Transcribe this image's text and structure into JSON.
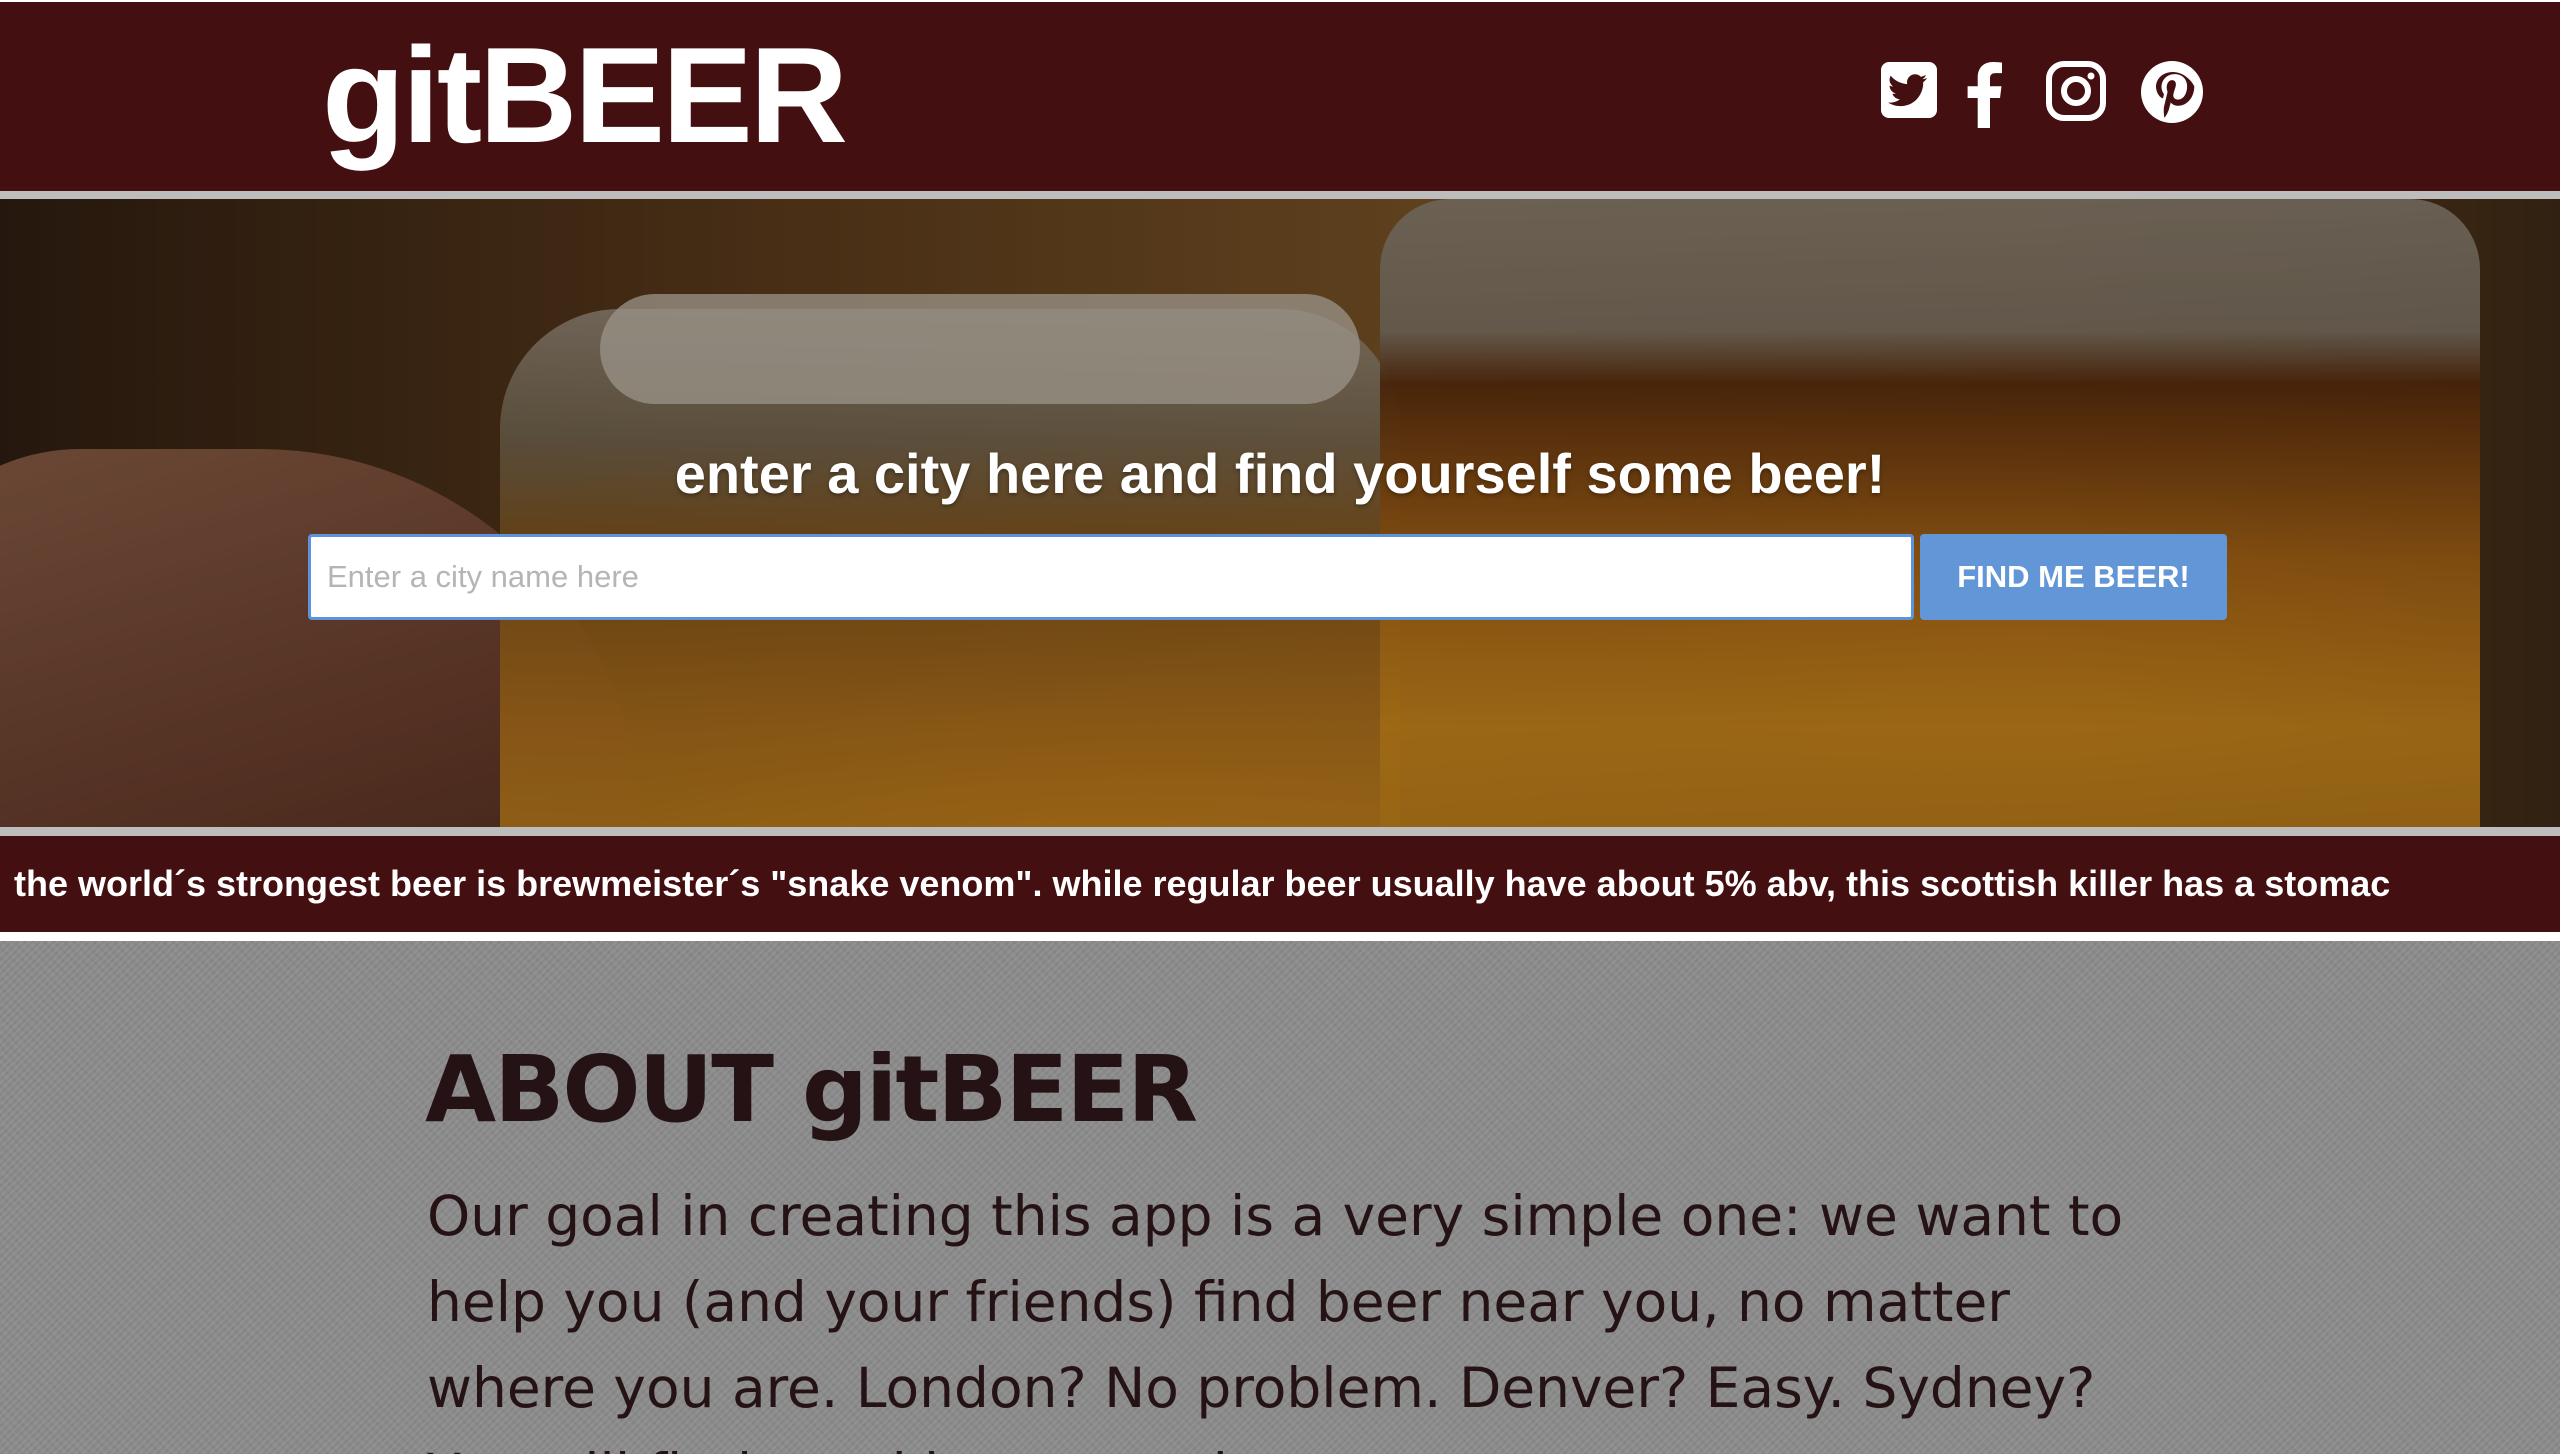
{
  "header": {
    "logo": "gitBEER",
    "social_icons": [
      "twitter-icon",
      "facebook-icon",
      "instagram-icon",
      "pinterest-icon"
    ]
  },
  "hero": {
    "title": "enter a city here and find yourself some beer!",
    "search": {
      "placeholder": "Enter a city name here",
      "value": "",
      "button_label": "FIND ME BEER!"
    }
  },
  "ticker": {
    "text": "the world´s strongest beer is brewmeister´s \"snake venom\". while regular beer usually have about 5% abv, this scottish killer has a stomac"
  },
  "about": {
    "title": "ABOUT gitBEER",
    "body": "Our goal in creating this app is a very simple one: we want to help you (and your friends) find beer near you, no matter where you are. London? No problem. Denver? Easy. Sydney? You will find good beer anywhere."
  },
  "colors": {
    "header_bg": "#430f11",
    "button_bg": "#6396d6",
    "input_border": "#5d93dc",
    "about_bg": "#8c8c8c",
    "about_text": "#251214"
  }
}
